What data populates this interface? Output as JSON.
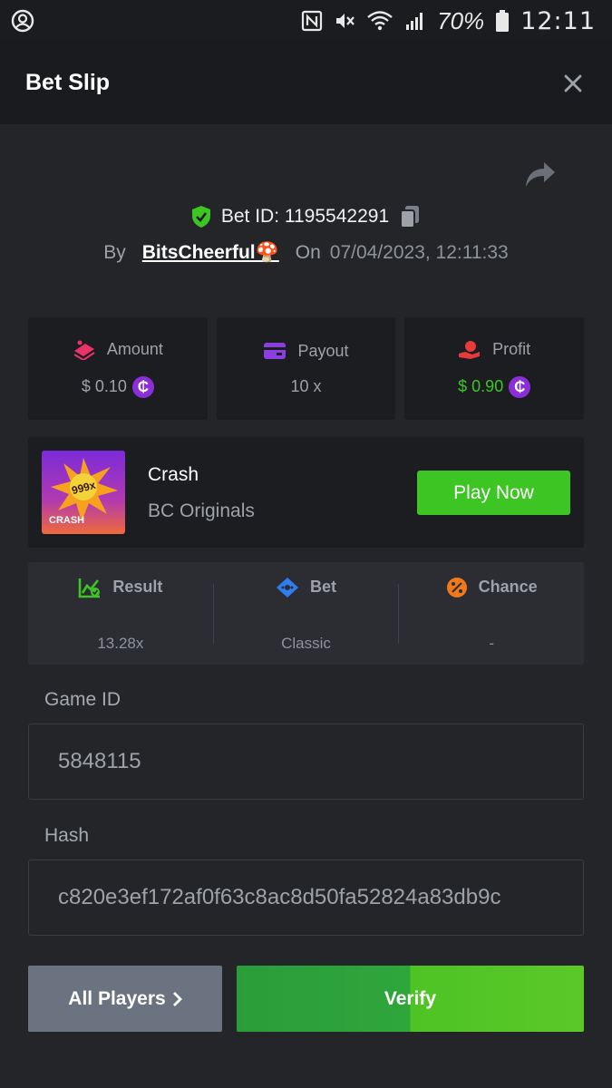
{
  "status_bar": {
    "battery": "70%",
    "time": "12:11"
  },
  "header": {
    "title": "Bet Slip"
  },
  "bet": {
    "id_label": "Bet ID: 1195542291",
    "by_label": "By",
    "user": "BitsCheerful🍄",
    "on_label": "On",
    "date": "07/04/2023, 12:11:33"
  },
  "stats": [
    {
      "label": "Amount",
      "value": "$ 0.10",
      "icon": "amount-icon"
    },
    {
      "label": "Payout",
      "value": "10 x",
      "icon": "card-icon"
    },
    {
      "label": "Profit",
      "value": "$ 0.90",
      "icon": "profit-icon"
    }
  ],
  "game": {
    "thumb_badge": "999x",
    "thumb_label": "CRASH",
    "name": "Crash",
    "provider": "BC Originals",
    "play_label": "Play Now"
  },
  "results": [
    {
      "label": "Result",
      "value": "13.28x",
      "icon": "chart-check-icon"
    },
    {
      "label": "Bet",
      "value": "Classic",
      "icon": "ticket-icon"
    },
    {
      "label": "Chance",
      "value": "-",
      "icon": "percent-icon"
    }
  ],
  "fields": {
    "game_id_label": "Game ID",
    "game_id_value": "5848115",
    "hash_label": "Hash",
    "hash_value": "c820e3ef172af0f63c8ac8d50fa52824a83db9c"
  },
  "actions": {
    "players_label": "All Players",
    "verify_label": "Verify"
  },
  "colors": {
    "accent_green": "#3dc524",
    "coin_purple": "#8a2fd8",
    "background": "#232529"
  }
}
